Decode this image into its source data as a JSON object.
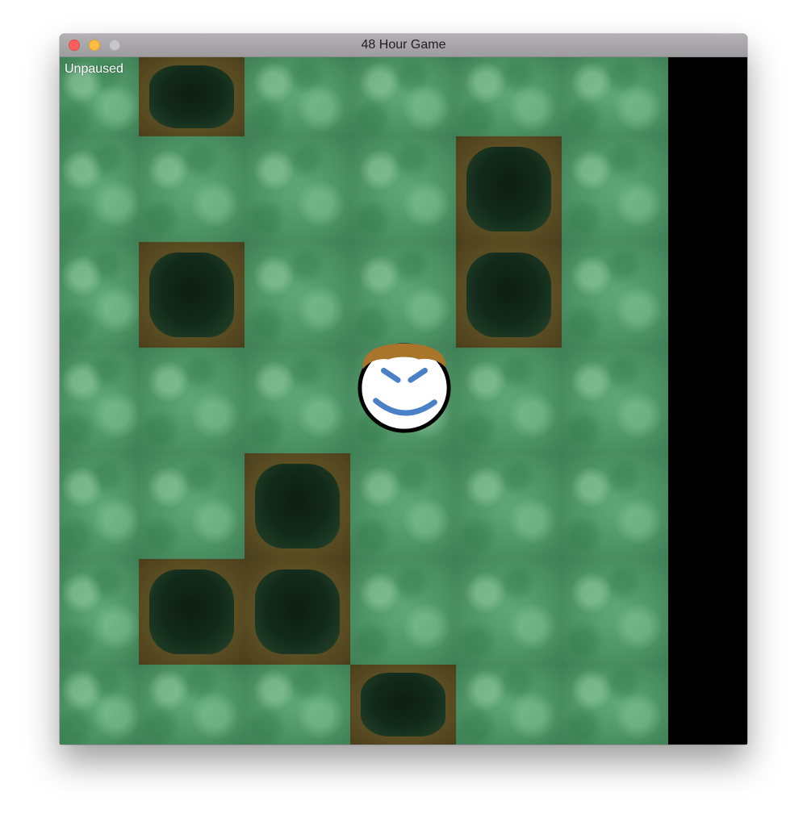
{
  "window": {
    "title": "48 Hour Game",
    "controls": [
      "close",
      "minimize",
      "zoom"
    ]
  },
  "hud": {
    "status": "Unpaused"
  },
  "map": {
    "cols": 6,
    "rows": 7,
    "pits": [
      [
        1,
        0
      ],
      [
        4,
        1
      ],
      [
        1,
        2
      ],
      [
        4,
        2
      ],
      [
        2,
        4
      ],
      [
        1,
        5
      ],
      [
        2,
        5
      ],
      [
        3,
        6
      ]
    ]
  },
  "player": {
    "col": 3,
    "row": 3,
    "face": "smiling-face",
    "colors": {
      "skin": "#ffffff",
      "outline": "#000000",
      "hair": "#a8752a",
      "features": "#4a80c8"
    }
  }
}
